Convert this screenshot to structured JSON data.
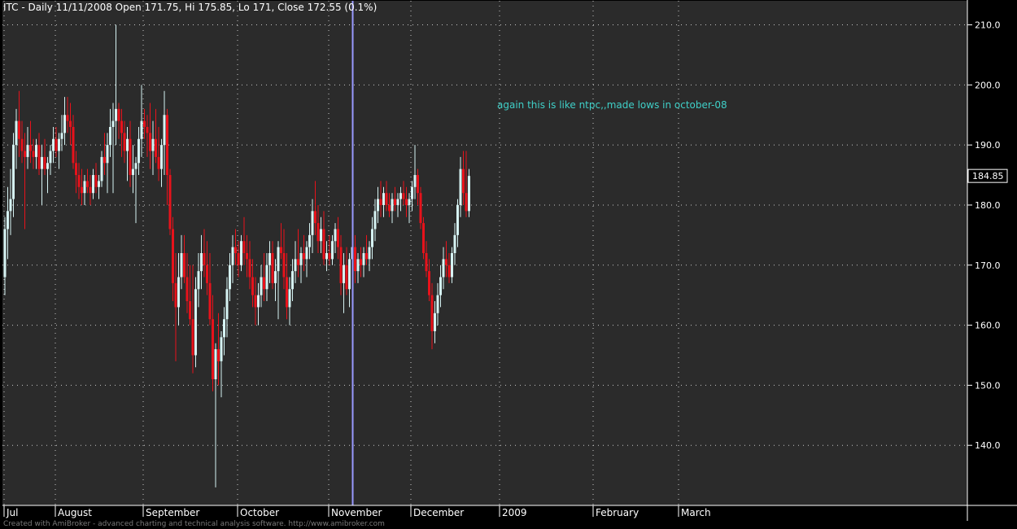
{
  "header": {
    "text": "ITC - Daily 11/11/2008 Open 171.75, Hi 175.85, Lo 171, Close 172.55 (0.1%)"
  },
  "annotation": "again this is like ntpc,,made lows in october-08",
  "credit": "Created with AmiBroker - advanced charting and technical analysis software. http://www.amibroker.com",
  "price_marker": "184.85",
  "colors": {
    "background": "#2b2b2b",
    "page": "#000000",
    "up": "#d6f3f3",
    "down": "#e8121b",
    "cursor": "#9999ff",
    "grid": "#c8c8c8",
    "text": "#ffffff",
    "annotation": "#3fd0c8"
  },
  "chart_data": {
    "type": "candlestick",
    "x_type": "trading-day",
    "ylim": [
      130,
      214
    ],
    "yticks": [
      140.0,
      150.0,
      160.0,
      170.0,
      180.0,
      190.0,
      200.0,
      210.0
    ],
    "grid": true,
    "date_range": [
      "2008-07",
      "2009-03"
    ],
    "x_labels": [
      {
        "label": "Jul",
        "index": 0
      },
      {
        "label": "August",
        "index": 18
      },
      {
        "label": "September",
        "index": 49
      },
      {
        "label": "October",
        "index": 82
      },
      {
        "label": "November",
        "index": 114
      },
      {
        "label": "December",
        "index": 143
      },
      {
        "label": "2009",
        "index": 174
      },
      {
        "label": "February",
        "index": 207
      },
      {
        "label": "March",
        "index": 237
      }
    ],
    "cursor_index": 122,
    "candles": [
      {
        "o": 168,
        "h": 178,
        "l": 165,
        "c": 176
      },
      {
        "o": 176,
        "h": 183,
        "l": 171,
        "c": 179
      },
      {
        "o": 179,
        "h": 186,
        "l": 175,
        "c": 181
      },
      {
        "o": 181,
        "h": 192,
        "l": 178,
        "c": 190
      },
      {
        "o": 190,
        "h": 196,
        "l": 186,
        "c": 194
      },
      {
        "o": 194,
        "h": 199,
        "l": 188,
        "c": 191
      },
      {
        "o": 191,
        "h": 194,
        "l": 187,
        "c": 189
      },
      {
        "o": 189,
        "h": 192,
        "l": 176,
        "c": 188
      },
      {
        "o": 188,
        "h": 193,
        "l": 186,
        "c": 190
      },
      {
        "o": 190,
        "h": 194,
        "l": 187,
        "c": 189
      },
      {
        "o": 189,
        "h": 191,
        "l": 186,
        "c": 188
      },
      {
        "o": 188,
        "h": 191,
        "l": 186,
        "c": 190
      },
      {
        "o": 190,
        "h": 192,
        "l": 185,
        "c": 186
      },
      {
        "o": 186,
        "h": 190,
        "l": 180,
        "c": 188
      },
      {
        "o": 188,
        "h": 191,
        "l": 185,
        "c": 186
      },
      {
        "o": 186,
        "h": 188,
        "l": 182,
        "c": 187
      },
      {
        "o": 187,
        "h": 190,
        "l": 185,
        "c": 189
      },
      {
        "o": 189,
        "h": 193,
        "l": 187,
        "c": 191
      },
      {
        "o": 191,
        "h": 193,
        "l": 188,
        "c": 189
      },
      {
        "o": 189,
        "h": 192,
        "l": 186,
        "c": 191
      },
      {
        "o": 191,
        "h": 195,
        "l": 189,
        "c": 192
      },
      {
        "o": 192,
        "h": 198,
        "l": 190,
        "c": 195
      },
      {
        "o": 195,
        "h": 198,
        "l": 192,
        "c": 194
      },
      {
        "o": 194,
        "h": 197,
        "l": 190,
        "c": 193
      },
      {
        "o": 193,
        "h": 195,
        "l": 186,
        "c": 187
      },
      {
        "o": 187,
        "h": 189,
        "l": 182,
        "c": 185
      },
      {
        "o": 185,
        "h": 187,
        "l": 181,
        "c": 183
      },
      {
        "o": 183,
        "h": 186,
        "l": 180,
        "c": 182
      },
      {
        "o": 182,
        "h": 185,
        "l": 180,
        "c": 184
      },
      {
        "o": 184,
        "h": 186,
        "l": 182,
        "c": 183
      },
      {
        "o": 183,
        "h": 185,
        "l": 180,
        "c": 182
      },
      {
        "o": 182,
        "h": 186,
        "l": 181,
        "c": 185
      },
      {
        "o": 185,
        "h": 187,
        "l": 182,
        "c": 183
      },
      {
        "o": 183,
        "h": 185,
        "l": 181,
        "c": 184
      },
      {
        "o": 184,
        "h": 189,
        "l": 183,
        "c": 188
      },
      {
        "o": 188,
        "h": 192,
        "l": 185,
        "c": 187
      },
      {
        "o": 187,
        "h": 192,
        "l": 182,
        "c": 190
      },
      {
        "o": 190,
        "h": 196,
        "l": 188,
        "c": 193
      },
      {
        "o": 193,
        "h": 197,
        "l": 182,
        "c": 194
      },
      {
        "o": 194,
        "h": 210,
        "l": 190,
        "c": 196
      },
      {
        "o": 196,
        "h": 197,
        "l": 191,
        "c": 194
      },
      {
        "o": 194,
        "h": 196,
        "l": 188,
        "c": 192
      },
      {
        "o": 192,
        "h": 194,
        "l": 187,
        "c": 189
      },
      {
        "o": 189,
        "h": 193,
        "l": 184,
        "c": 191
      },
      {
        "o": 191,
        "h": 194,
        "l": 183,
        "c": 185
      },
      {
        "o": 185,
        "h": 190,
        "l": 182,
        "c": 186
      },
      {
        "o": 186,
        "h": 188,
        "l": 177,
        "c": 187
      },
      {
        "o": 187,
        "h": 193,
        "l": 185,
        "c": 191
      },
      {
        "o": 191,
        "h": 200,
        "l": 188,
        "c": 194
      },
      {
        "o": 194,
        "h": 196,
        "l": 191,
        "c": 193
      },
      {
        "o": 193,
        "h": 195,
        "l": 188,
        "c": 192
      },
      {
        "o": 192,
        "h": 197,
        "l": 186,
        "c": 189
      },
      {
        "o": 189,
        "h": 194,
        "l": 185,
        "c": 191
      },
      {
        "o": 191,
        "h": 196,
        "l": 187,
        "c": 188
      },
      {
        "o": 188,
        "h": 193,
        "l": 184,
        "c": 186
      },
      {
        "o": 186,
        "h": 191,
        "l": 183,
        "c": 190
      },
      {
        "o": 190,
        "h": 199,
        "l": 185,
        "c": 195
      },
      {
        "o": 195,
        "h": 196,
        "l": 180,
        "c": 185
      },
      {
        "o": 185,
        "h": 186,
        "l": 175,
        "c": 176
      },
      {
        "o": 176,
        "h": 178,
        "l": 164,
        "c": 167
      },
      {
        "o": 167,
        "h": 172,
        "l": 154,
        "c": 163
      },
      {
        "o": 163,
        "h": 172,
        "l": 160,
        "c": 168
      },
      {
        "o": 168,
        "h": 175,
        "l": 166,
        "c": 172
      },
      {
        "o": 172,
        "h": 175,
        "l": 167,
        "c": 168
      },
      {
        "o": 168,
        "h": 172,
        "l": 162,
        "c": 164
      },
      {
        "o": 164,
        "h": 170,
        "l": 160,
        "c": 161
      },
      {
        "o": 161,
        "h": 170,
        "l": 152,
        "c": 155
      },
      {
        "o": 155,
        "h": 168,
        "l": 153,
        "c": 166
      },
      {
        "o": 166,
        "h": 172,
        "l": 163,
        "c": 169
      },
      {
        "o": 169,
        "h": 175,
        "l": 166,
        "c": 172
      },
      {
        "o": 172,
        "h": 176,
        "l": 168,
        "c": 170
      },
      {
        "o": 170,
        "h": 174,
        "l": 165,
        "c": 167
      },
      {
        "o": 167,
        "h": 172,
        "l": 160,
        "c": 161
      },
      {
        "o": 161,
        "h": 165,
        "l": 149,
        "c": 151
      },
      {
        "o": 151,
        "h": 157,
        "l": 133,
        "c": 156
      },
      {
        "o": 156,
        "h": 162,
        "l": 150,
        "c": 154
      },
      {
        "o": 154,
        "h": 159,
        "l": 148,
        "c": 158
      },
      {
        "o": 158,
        "h": 163,
        "l": 155,
        "c": 161
      },
      {
        "o": 161,
        "h": 168,
        "l": 158,
        "c": 166
      },
      {
        "o": 166,
        "h": 172,
        "l": 164,
        "c": 170
      },
      {
        "o": 170,
        "h": 175,
        "l": 167,
        "c": 173
      },
      {
        "o": 173,
        "h": 176,
        "l": 170,
        "c": 172
      },
      {
        "o": 172,
        "h": 174,
        "l": 168,
        "c": 170
      },
      {
        "o": 170,
        "h": 175,
        "l": 169,
        "c": 174
      },
      {
        "o": 174,
        "h": 178,
        "l": 170,
        "c": 172
      },
      {
        "o": 172,
        "h": 175,
        "l": 168,
        "c": 171
      },
      {
        "o": 171,
        "h": 174,
        "l": 166,
        "c": 168
      },
      {
        "o": 168,
        "h": 171,
        "l": 163,
        "c": 165
      },
      {
        "o": 165,
        "h": 168,
        "l": 160,
        "c": 163
      },
      {
        "o": 163,
        "h": 167,
        "l": 160,
        "c": 165
      },
      {
        "o": 165,
        "h": 170,
        "l": 163,
        "c": 168
      },
      {
        "o": 168,
        "h": 172,
        "l": 164,
        "c": 166
      },
      {
        "o": 166,
        "h": 172,
        "l": 164,
        "c": 170
      },
      {
        "o": 170,
        "h": 174,
        "l": 167,
        "c": 172
      },
      {
        "o": 172,
        "h": 174,
        "l": 166,
        "c": 167
      },
      {
        "o": 167,
        "h": 171,
        "l": 164,
        "c": 169
      },
      {
        "o": 169,
        "h": 174,
        "l": 161,
        "c": 173
      },
      {
        "o": 173,
        "h": 177,
        "l": 171,
        "c": 172
      },
      {
        "o": 172,
        "h": 176,
        "l": 166,
        "c": 168
      },
      {
        "o": 168,
        "h": 172,
        "l": 161,
        "c": 163
      },
      {
        "o": 163,
        "h": 168,
        "l": 160,
        "c": 166
      },
      {
        "o": 166,
        "h": 171,
        "l": 164,
        "c": 169
      },
      {
        "o": 169,
        "h": 174,
        "l": 167,
        "c": 171
      },
      {
        "o": 171,
        "h": 176,
        "l": 168,
        "c": 170
      },
      {
        "o": 170,
        "h": 173,
        "l": 167,
        "c": 172
      },
      {
        "o": 172,
        "h": 175,
        "l": 169,
        "c": 171
      },
      {
        "o": 171,
        "h": 174,
        "l": 168,
        "c": 173
      },
      {
        "o": 173,
        "h": 177,
        "l": 171,
        "c": 175
      },
      {
        "o": 175,
        "h": 181,
        "l": 172,
        "c": 179
      },
      {
        "o": 179,
        "h": 184,
        "l": 175,
        "c": 177
      },
      {
        "o": 177,
        "h": 180,
        "l": 172,
        "c": 174
      },
      {
        "o": 174,
        "h": 178,
        "l": 172,
        "c": 176
      },
      {
        "o": 176,
        "h": 179,
        "l": 170,
        "c": 171
      },
      {
        "o": 171,
        "h": 174,
        "l": 169,
        "c": 172
      },
      {
        "o": 172,
        "h": 175,
        "l": 170,
        "c": 171
      },
      {
        "o": 171,
        "h": 175,
        "l": 170,
        "c": 174
      },
      {
        "o": 174,
        "h": 177,
        "l": 172,
        "c": 176
      },
      {
        "o": 176,
        "h": 178,
        "l": 171,
        "c": 173
      },
      {
        "o": 173,
        "h": 175,
        "l": 165,
        "c": 167
      },
      {
        "o": 167,
        "h": 172,
        "l": 162,
        "c": 170
      },
      {
        "o": 170,
        "h": 173,
        "l": 165,
        "c": 166
      },
      {
        "o": 166,
        "h": 172,
        "l": 163,
        "c": 171
      },
      {
        "o": 171,
        "h": 175,
        "l": 169,
        "c": 173
      },
      {
        "o": 173,
        "h": 175,
        "l": 167,
        "c": 169
      },
      {
        "o": 169,
        "h": 172,
        "l": 167,
        "c": 171
      },
      {
        "o": 171,
        "h": 173,
        "l": 168,
        "c": 170
      },
      {
        "o": 170,
        "h": 173,
        "l": 168,
        "c": 172
      },
      {
        "o": 172,
        "h": 175,
        "l": 170,
        "c": 171
      },
      {
        "o": 171,
        "h": 174,
        "l": 169,
        "c": 173
      },
      {
        "o": 173,
        "h": 178,
        "l": 171,
        "c": 176
      },
      {
        "o": 176,
        "h": 181,
        "l": 174,
        "c": 179
      },
      {
        "o": 179,
        "h": 183,
        "l": 177,
        "c": 181
      },
      {
        "o": 181,
        "h": 184,
        "l": 178,
        "c": 180
      },
      {
        "o": 180,
        "h": 183,
        "l": 178,
        "c": 182
      },
      {
        "o": 182,
        "h": 184,
        "l": 179,
        "c": 180
      },
      {
        "o": 180,
        "h": 182,
        "l": 178,
        "c": 179
      },
      {
        "o": 179,
        "h": 182,
        "l": 177,
        "c": 181
      },
      {
        "o": 181,
        "h": 183,
        "l": 179,
        "c": 180
      },
      {
        "o": 180,
        "h": 182,
        "l": 178,
        "c": 181
      },
      {
        "o": 181,
        "h": 183,
        "l": 179,
        "c": 182
      },
      {
        "o": 182,
        "h": 184,
        "l": 180,
        "c": 181
      },
      {
        "o": 181,
        "h": 183,
        "l": 178,
        "c": 180
      },
      {
        "o": 180,
        "h": 182,
        "l": 177,
        "c": 181
      },
      {
        "o": 181,
        "h": 184,
        "l": 179,
        "c": 183
      },
      {
        "o": 183,
        "h": 190,
        "l": 181,
        "c": 185
      },
      {
        "o": 185,
        "h": 186,
        "l": 180,
        "c": 182
      },
      {
        "o": 182,
        "h": 183,
        "l": 176,
        "c": 177
      },
      {
        "o": 177,
        "h": 178,
        "l": 171,
        "c": 172
      },
      {
        "o": 172,
        "h": 174,
        "l": 168,
        "c": 169
      },
      {
        "o": 169,
        "h": 171,
        "l": 164,
        "c": 165
      },
      {
        "o": 165,
        "h": 167,
        "l": 156,
        "c": 159
      },
      {
        "o": 159,
        "h": 164,
        "l": 157,
        "c": 162
      },
      {
        "o": 162,
        "h": 167,
        "l": 160,
        "c": 165
      },
      {
        "o": 165,
        "h": 170,
        "l": 163,
        "c": 168
      },
      {
        "o": 168,
        "h": 173,
        "l": 166,
        "c": 171
      },
      {
        "o": 171,
        "h": 174,
        "l": 168,
        "c": 170
      },
      {
        "o": 170,
        "h": 172,
        "l": 167,
        "c": 168
      },
      {
        "o": 168,
        "h": 173,
        "l": 167,
        "c": 172
      },
      {
        "o": 172,
        "h": 177,
        "l": 170,
        "c": 175
      },
      {
        "o": 175,
        "h": 181,
        "l": 173,
        "c": 180
      },
      {
        "o": 180,
        "h": 188,
        "l": 178,
        "c": 186
      },
      {
        "o": 186,
        "h": 189,
        "l": 180,
        "c": 182
      },
      {
        "o": 182,
        "h": 189,
        "l": 178,
        "c": 179
      },
      {
        "o": 179,
        "h": 186,
        "l": 178,
        "c": 184.85
      }
    ]
  }
}
